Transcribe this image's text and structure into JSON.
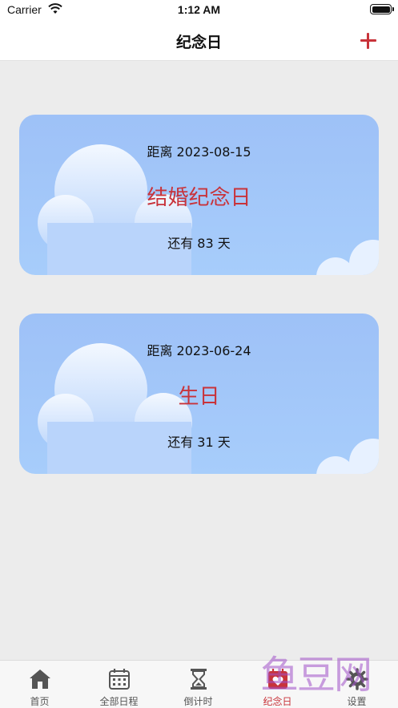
{
  "status_bar": {
    "carrier": "Carrier",
    "time": "1:12 AM"
  },
  "nav": {
    "title": "纪念日",
    "add_icon": "plus-icon",
    "accent_color": "#c8333a"
  },
  "events": [
    {
      "from": "距离 2023-08-15",
      "name": "结婚纪念日",
      "remaining": "还有 83 天"
    },
    {
      "from": "距离 2023-06-24",
      "name": "生日",
      "remaining": "还有 31 天"
    }
  ],
  "tabs": [
    {
      "label": "首页",
      "icon": "home-icon"
    },
    {
      "label": "全部日程",
      "icon": "calendar-icon"
    },
    {
      "label": "倒计时",
      "icon": "hourglass-icon"
    },
    {
      "label": "纪念日",
      "icon": "heart-icon",
      "active": true
    },
    {
      "label": "设置",
      "icon": "gear-icon"
    }
  ],
  "watermark": "鱼豆网"
}
